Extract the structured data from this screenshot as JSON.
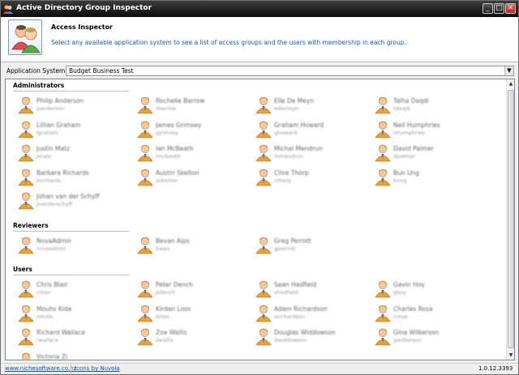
{
  "window": {
    "title": "Active Directory Group Inspector",
    "minimize": "_",
    "maximize": "□",
    "close": "✕"
  },
  "header": {
    "title": "Access Inspector",
    "description": "Select any available application system to see a list of access groups and the users with membership in each group."
  },
  "system": {
    "label": "Application System",
    "selected": "Budget Business Test"
  },
  "groups": [
    {
      "name": "Administrators",
      "users": [
        {
          "name": "Philip Anderson",
          "login": "panderson"
        },
        {
          "name": "Rochelle Barrow",
          "login": "rbarrow"
        },
        {
          "name": "Elle De Meyn",
          "login": "edemeyn"
        },
        {
          "name": "Talha Daqdi",
          "login": "tdaqdi"
        },
        {
          "name": "Lillian Graham",
          "login": "lgraham"
        },
        {
          "name": "James Grimsey",
          "login": "jgrimsey"
        },
        {
          "name": "Graham Howard",
          "login": "ghoward"
        },
        {
          "name": "Neil Humphries",
          "login": "nhumphries"
        },
        {
          "name": "Justin Matz",
          "login": "jmatz"
        },
        {
          "name": "Ian McBeath",
          "login": "imcbeath"
        },
        {
          "name": "Michal Mendrun",
          "login": "mmendrun"
        },
        {
          "name": "David Palmer",
          "login": "dpalmer"
        },
        {
          "name": "Barbara Richards",
          "login": "brichards"
        },
        {
          "name": "Austin Skelton",
          "login": "askelton"
        },
        {
          "name": "Clive Thorp",
          "login": "cthorp"
        },
        {
          "name": "Bun Ung",
          "login": "bung"
        },
        {
          "name": "Johan van der Schyff",
          "login": "jvanderschyff"
        }
      ]
    },
    {
      "name": "Reviewers",
      "users": [
        {
          "name": "NovaAdmin",
          "login": "novaadmin"
        },
        {
          "name": "Bevan Aips",
          "login": "baips"
        },
        {
          "name": "Greg Perrott",
          "login": "gperrott"
        }
      ]
    },
    {
      "name": "Users",
      "users": [
        {
          "name": "Chris Blair",
          "login": "cblair"
        },
        {
          "name": "Peter Dench",
          "login": "pdench"
        },
        {
          "name": "Sean Hadfield",
          "login": "shadfield"
        },
        {
          "name": "Gavin Hoy",
          "login": "ghoy"
        },
        {
          "name": "Mouhs Kida",
          "login": "mkida"
        },
        {
          "name": "Kirdan Loos",
          "login": "kloos"
        },
        {
          "name": "Adam Richardson",
          "login": "arichardson"
        },
        {
          "name": "Charles Rosa",
          "login": "crosa"
        },
        {
          "name": "Richard Wallace",
          "login": "rwallace"
        },
        {
          "name": "Zoe Wallis",
          "login": "zwallis"
        },
        {
          "name": "Douglas Widdowson",
          "login": "dwiddowson"
        },
        {
          "name": "Gina Wilkerson",
          "login": "gwilkerson"
        },
        {
          "name": "Victoria Zi",
          "login": ""
        }
      ]
    }
  ],
  "footer": {
    "link1": "www.nichesoftware.co.nz",
    "link2": "Icons by Nuvola",
    "version": "1.0.12.3393"
  },
  "colors": {
    "titlebar": "#0d0d0d",
    "link": "#1a46d0",
    "description": "#1f5aa8"
  },
  "icons": [
    "application-icon",
    "user-group-icon",
    "person-icon",
    "dropdown-arrow-icon"
  ]
}
